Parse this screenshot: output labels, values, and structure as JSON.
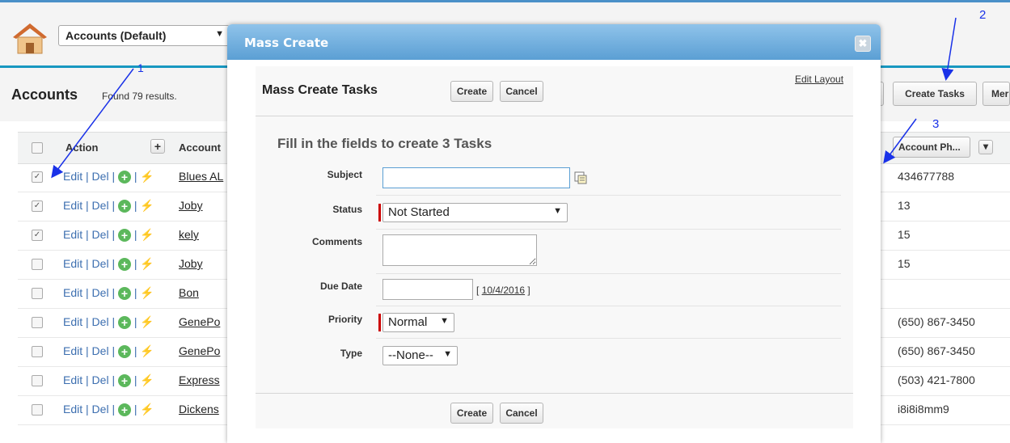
{
  "header": {
    "view_label": "Accounts (Default)",
    "view_arrow": "▼"
  },
  "page": {
    "title": "Accounts",
    "found": "Found 79 results."
  },
  "toolbar": {
    "create_tasks": "Create Tasks",
    "more": "Mer"
  },
  "grid": {
    "action_header": "Action",
    "plus_header": "+",
    "account_header": "Account",
    "phone_header": "Account Ph...",
    "phone_menu": "▾",
    "checked_mark": "✓",
    "edit": "Edit",
    "del": "Del",
    "sep": "|",
    "add_glyph": "+",
    "bolt_glyph": "⚡",
    "rows": [
      {
        "name": "Blues AL",
        "phone": "434677788",
        "checked": true
      },
      {
        "name": "Joby",
        "phone": "13",
        "checked": true
      },
      {
        "name": "kely",
        "phone": "15",
        "checked": true
      },
      {
        "name": "Joby",
        "phone": "15",
        "checked": false
      },
      {
        "name": "Bon",
        "phone": "",
        "checked": false
      },
      {
        "name": "GenePo",
        "phone": "(650) 867-3450",
        "checked": false
      },
      {
        "name": "GenePo",
        "phone": "(650) 867-3450",
        "checked": false
      },
      {
        "name": "Express",
        "phone": "(503) 421-7800",
        "checked": false
      },
      {
        "name": "Dickens",
        "phone": "i8i8i8mm9",
        "checked": false
      }
    ]
  },
  "modal": {
    "title": "Mass Create",
    "close": "✖",
    "heading": "Mass Create Tasks",
    "create": "Create",
    "cancel": "Cancel",
    "edit_layout": "Edit Layout",
    "section_title": "Fill in the fields to create 3 Tasks",
    "fields": {
      "subject_label": "Subject",
      "subject_value": "",
      "status_label": "Status",
      "status_value": "Not Started",
      "comments_label": "Comments",
      "comments_value": "",
      "due_label": "Due Date",
      "due_value": "",
      "due_link": "10/4/2016",
      "bracket_open": "[",
      "bracket_close": "]",
      "priority_label": "Priority",
      "priority_value": "Normal",
      "type_label": "Type",
      "type_value": "--None--",
      "arrow": "▼"
    }
  },
  "annotations": {
    "one": "1",
    "two": "2",
    "three": "3",
    "color": "#1a32e8"
  }
}
